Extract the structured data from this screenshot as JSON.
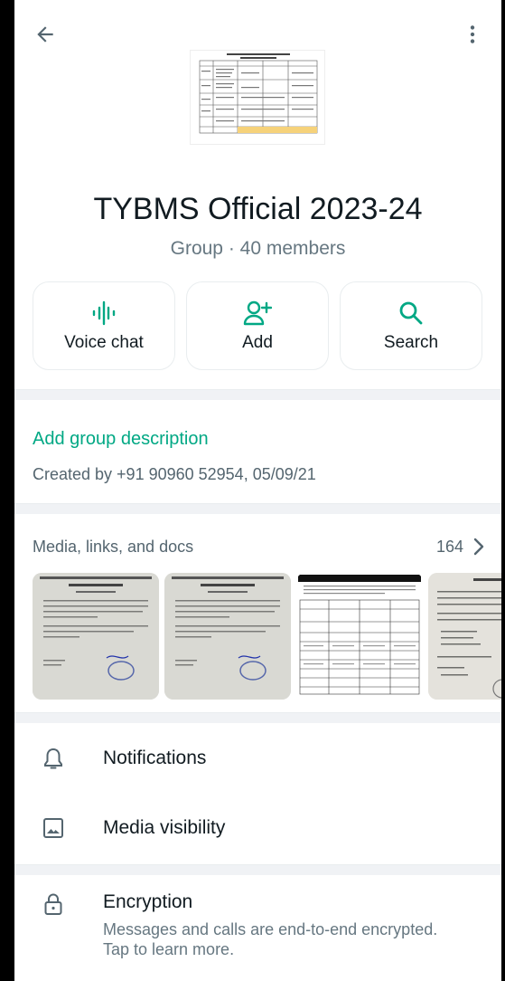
{
  "group": {
    "name": "TYBMS Official 2023-24",
    "subtitle": "Group · 40 members"
  },
  "actions": [
    {
      "label": "Voice chat",
      "icon": "voice-chat-icon"
    },
    {
      "label": "Add",
      "icon": "add-person-icon"
    },
    {
      "label": "Search",
      "icon": "search-icon"
    }
  ],
  "description": {
    "link": "Add group description",
    "created": "Created by +91 90960 52954, 05/09/21"
  },
  "media": {
    "title": "Media, links, and docs",
    "count": "164"
  },
  "settings": {
    "notifications": "Notifications",
    "media_visibility": "Media visibility",
    "encryption": "Encryption",
    "encryption_sub": "Messages and calls are end-to-end encrypted. Tap to learn more."
  },
  "colors": {
    "accent": "#00a884",
    "text": "#111b21",
    "secondary": "#667781"
  }
}
